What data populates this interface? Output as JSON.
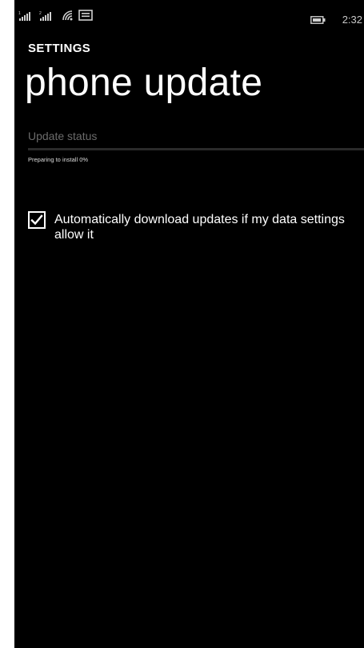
{
  "status_bar": {
    "icons": [
      "signal-strength-1-icon",
      "signal-strength-2-icon",
      "wifi-icon",
      "message-icon",
      "battery-icon"
    ],
    "sim1_number": "1",
    "sim2_number": "2",
    "time": "2:32"
  },
  "header": {
    "section": "SETTINGS",
    "title": "phone update"
  },
  "update": {
    "status_label": "Update status",
    "progress_text": "Preparing to install 0%",
    "progress_value": 0
  },
  "options": {
    "auto_download": {
      "label": "Automatically download updates if my data settings allow it",
      "checked": true
    }
  },
  "colors": {
    "background": "#000000",
    "text": "#ffffff",
    "subtle_text": "#6b6b6b"
  }
}
